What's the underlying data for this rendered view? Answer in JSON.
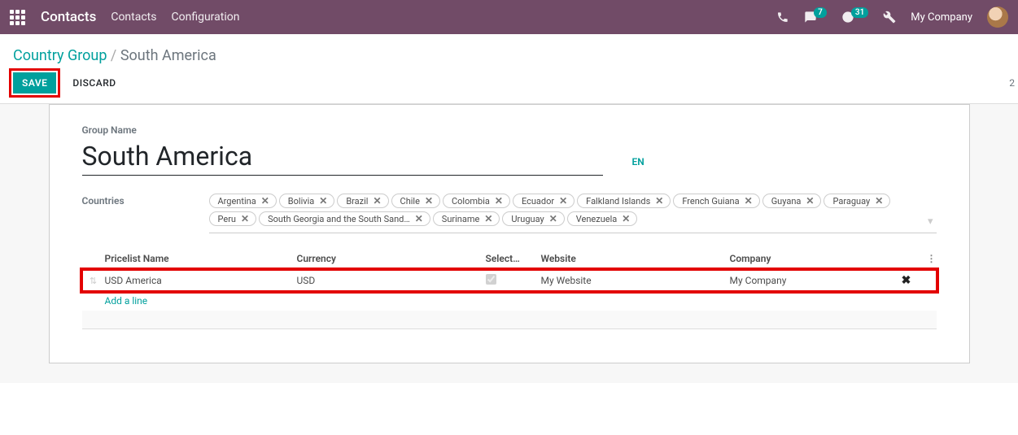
{
  "header": {
    "app_title": "Contacts",
    "nav": {
      "contacts": "Contacts",
      "configuration": "Configuration"
    },
    "msg_badge": "7",
    "activity_badge": "31",
    "company": "My Company"
  },
  "breadcrumb": {
    "parent": "Country Group",
    "sep": "/",
    "current": "South America"
  },
  "buttons": {
    "save": "SAVE",
    "discard": "DISCARD"
  },
  "page_indicator": "2",
  "form": {
    "group_name_label": "Group Name",
    "group_name_value": "South America",
    "lang_btn": "EN",
    "countries_label": "Countries",
    "countries": [
      "Argentina",
      "Bolivia",
      "Brazil",
      "Chile",
      "Colombia",
      "Ecuador",
      "Falkland Islands",
      "French Guiana",
      "Guyana",
      "Paraguay",
      "Peru",
      "South Georgia and the South Sand…",
      "Suriname",
      "Uruguay",
      "Venezuela"
    ],
    "pricelist": {
      "headers": {
        "name": "Pricelist Name",
        "currency": "Currency",
        "select": "Select…",
        "website": "Website",
        "company": "Company"
      },
      "rows": [
        {
          "name": "USD America",
          "currency": "USD",
          "selectable": true,
          "website": "My Website",
          "company": "My Company"
        }
      ],
      "add_line": "Add a line"
    }
  }
}
